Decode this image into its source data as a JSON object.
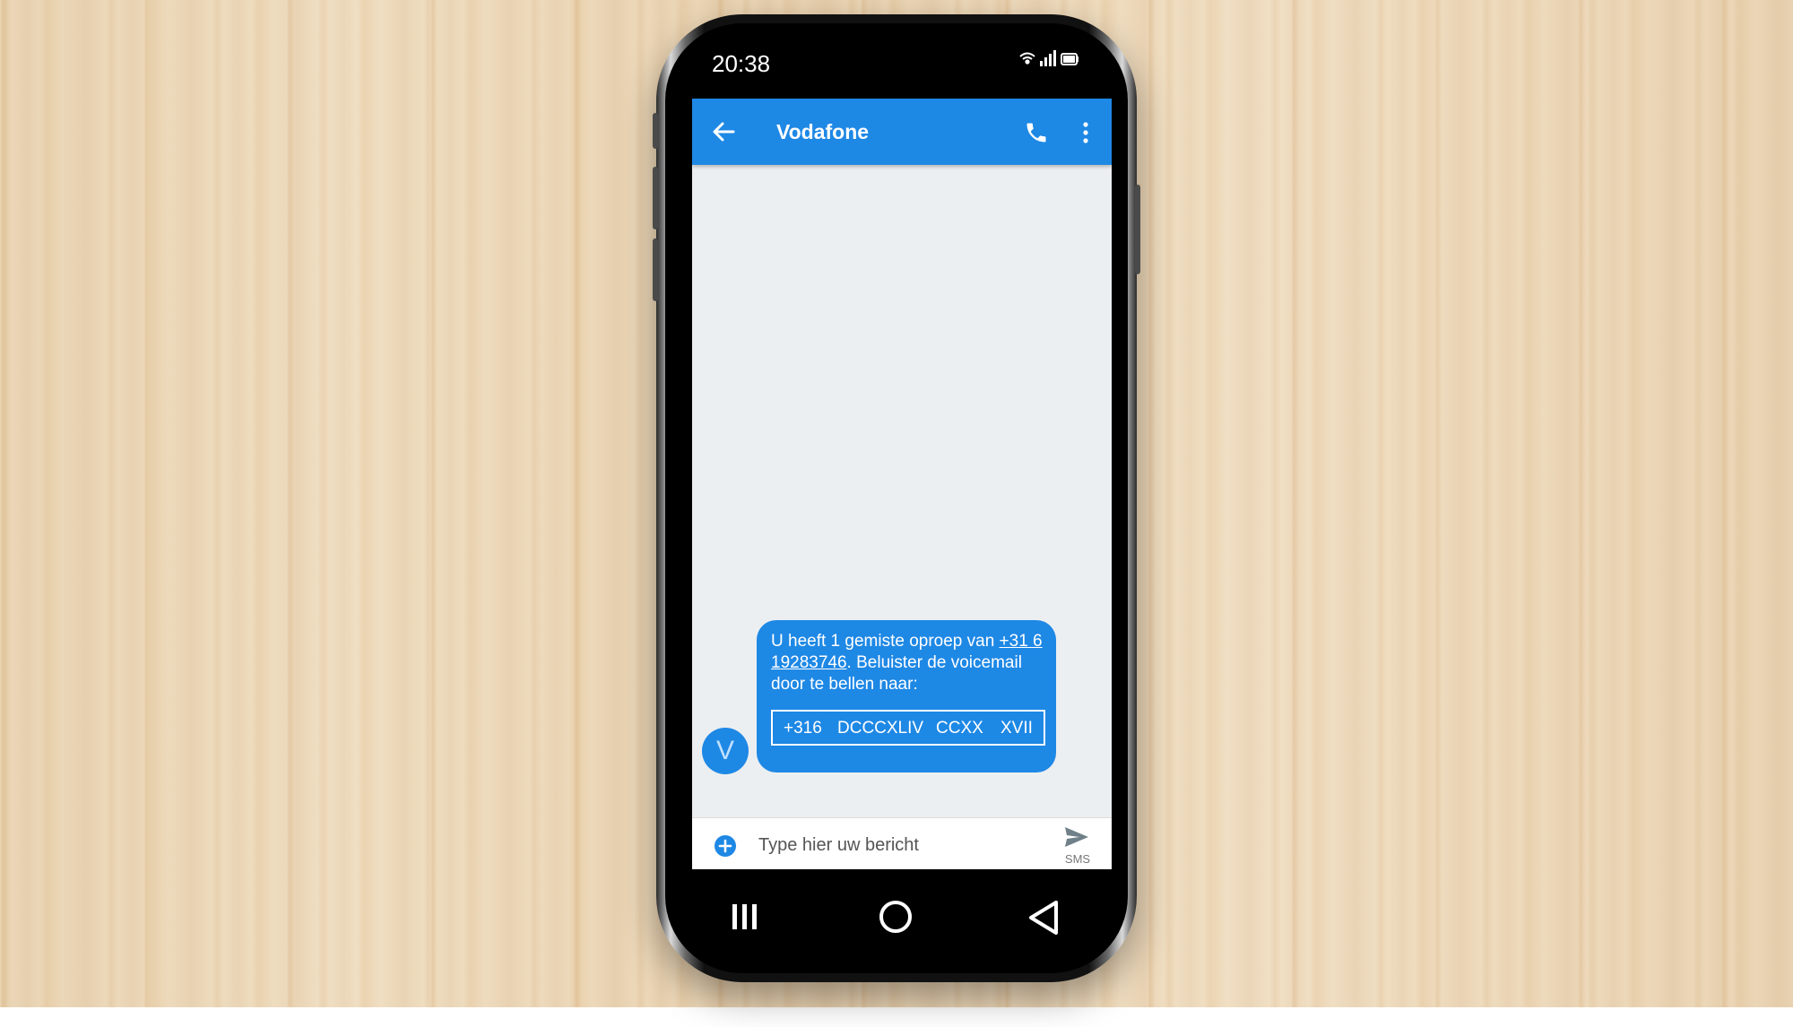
{
  "status_bar": {
    "time": "20:38",
    "icons": [
      "wifi-icon",
      "signal-icon",
      "battery-icon"
    ]
  },
  "app_bar": {
    "title": "Vodafone",
    "icons": [
      "back-arrow-icon",
      "phone-icon",
      "more-vert-icon"
    ],
    "color": "#1e88e5"
  },
  "conversation": {
    "avatar_letter": "V",
    "message": {
      "text_before": "U heeft 1 gemiste oproep van ",
      "link": "+31 6 19283746",
      "text_after": ". Beluister de voicemail door te bellen naar:",
      "code_parts": [
        "+316",
        "DCCCXLIV",
        "CCXX",
        "XVII"
      ]
    }
  },
  "composer": {
    "placeholder": "Type hier uw bericht",
    "send_label": "SMS",
    "icons": [
      "add-circle-icon",
      "send-icon"
    ]
  },
  "navigation": {
    "icons": [
      "recent-apps-icon",
      "home-icon",
      "back-icon"
    ]
  }
}
